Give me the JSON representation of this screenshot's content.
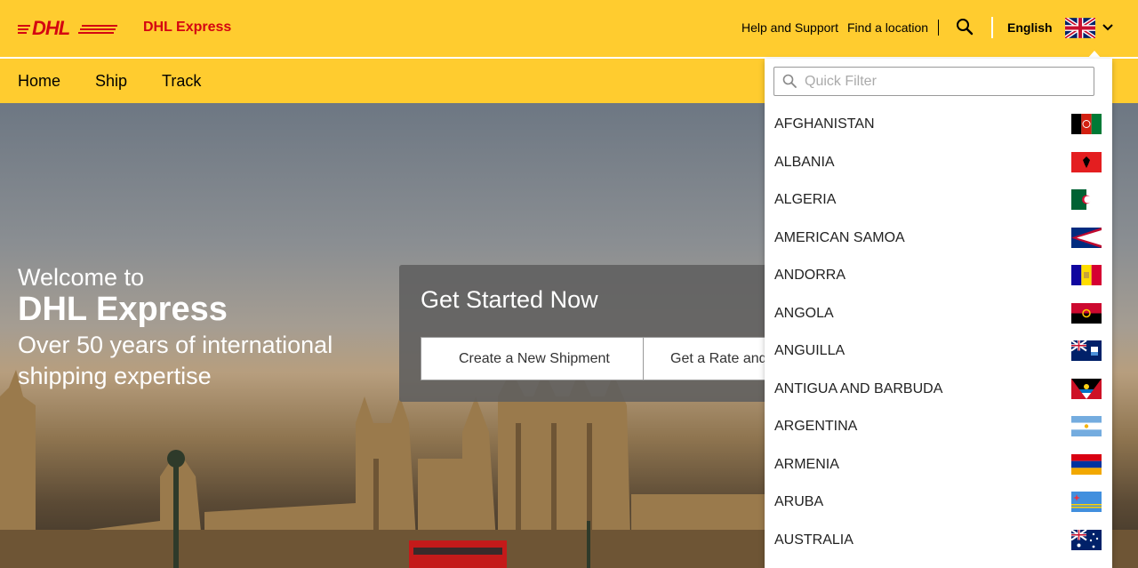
{
  "header": {
    "brand": "DHL Express",
    "links": [
      "Help and Support",
      "Find a location"
    ],
    "language": "English",
    "colors": {
      "yellow": "#ffcc2f",
      "red": "#d40511"
    }
  },
  "nav": {
    "items": [
      "Home",
      "Ship",
      "Track"
    ]
  },
  "hero": {
    "welcome_line1": "Welcome to",
    "welcome_line2": "DHL Express",
    "welcome_line3": "Over 50 years of international shipping expertise"
  },
  "get_started": {
    "title": "Get Started Now",
    "create_label": "Create a New Shipment",
    "rate_label": "Get a Rate and"
  },
  "country_dropdown": {
    "filter_placeholder": "Quick Filter",
    "countries": [
      {
        "name": "AFGHANISTAN",
        "flag": "afghanistan-flag-icon"
      },
      {
        "name": "ALBANIA",
        "flag": "albania-flag-icon"
      },
      {
        "name": "ALGERIA",
        "flag": "algeria-flag-icon"
      },
      {
        "name": "AMERICAN SAMOA",
        "flag": "american-samoa-flag-icon"
      },
      {
        "name": "ANDORRA",
        "flag": "andorra-flag-icon"
      },
      {
        "name": "ANGOLA",
        "flag": "angola-flag-icon"
      },
      {
        "name": "ANGUILLA",
        "flag": "anguilla-flag-icon"
      },
      {
        "name": "ANTIGUA AND BARBUDA",
        "flag": "antigua-and-barbuda-flag-icon"
      },
      {
        "name": "ARGENTINA",
        "flag": "argentina-flag-icon"
      },
      {
        "name": "ARMENIA",
        "flag": "armenia-flag-icon"
      },
      {
        "name": "ARUBA",
        "flag": "aruba-flag-icon"
      },
      {
        "name": "AUSTRALIA",
        "flag": "australia-flag-icon"
      }
    ]
  }
}
